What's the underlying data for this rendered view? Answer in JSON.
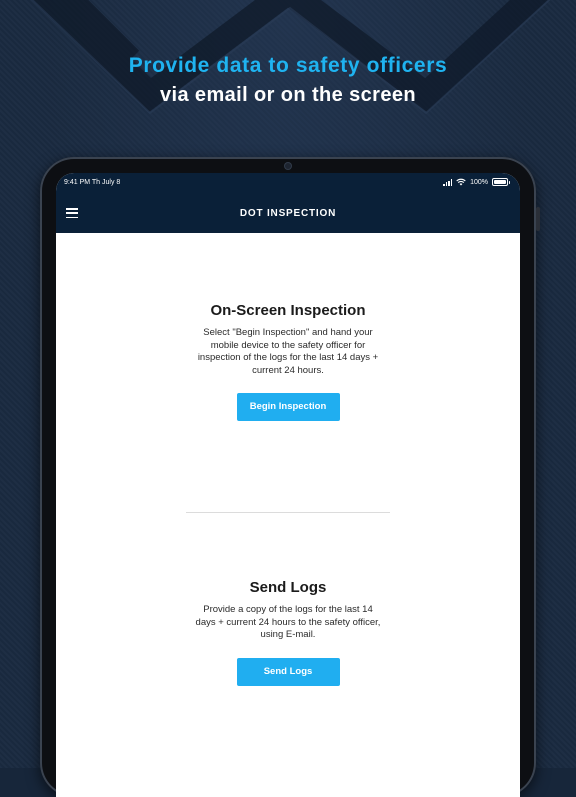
{
  "promo": {
    "line1": "Provide data to safety officers",
    "line2": "via email or on the screen"
  },
  "colors": {
    "accent": "#1fb3f0",
    "button": "#20aef0",
    "nav_background": "#0a2038",
    "page_background": "#17263a"
  },
  "status_bar": {
    "time_date": "9:41 PM   Th July 8",
    "battery": "100%",
    "icons": [
      "signal-icon",
      "wifi-icon",
      "battery-icon"
    ]
  },
  "nav": {
    "title": "DOT INSPECTION",
    "menu_icon": "hamburger-menu-icon"
  },
  "onscreen": {
    "title": "On-Screen Inspection",
    "description": "Select \"Begin Inspection\" and hand your mobile device to the safety officer for inspection of the logs for the last 14 days + current 24 hours.",
    "button_label": "Begin Inspection"
  },
  "send_logs": {
    "title": "Send Logs",
    "description": "Provide a copy of the logs for the last  14  days + current 24 hours to the safety officer, using E-mail.",
    "button_label": "Send Logs"
  }
}
